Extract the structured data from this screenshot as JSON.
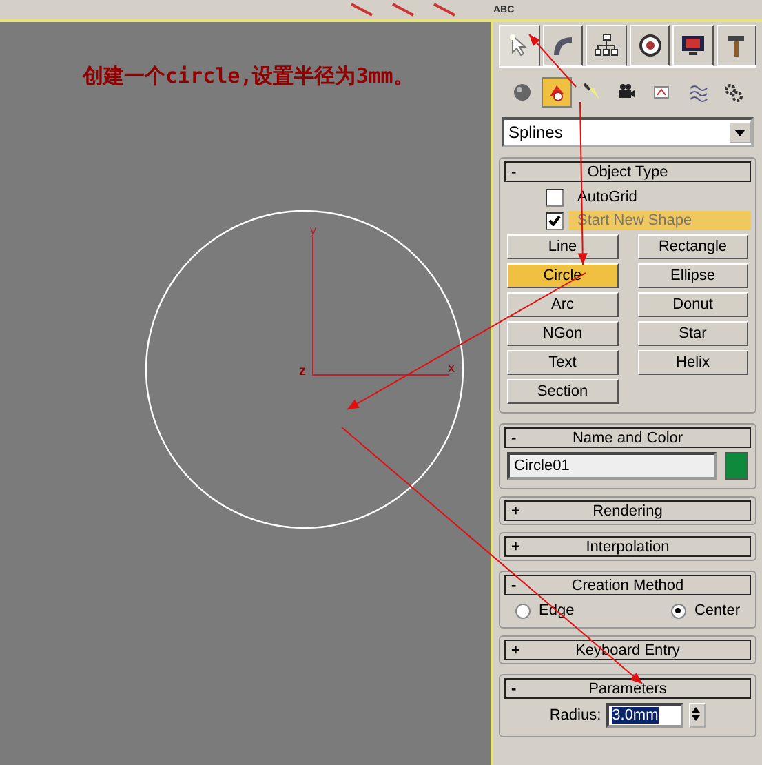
{
  "toolbar": {
    "label": "ABC"
  },
  "viewport": {
    "annotation": "创建一个circle,设置半径为3mm。",
    "axis_labels": {
      "x": "x",
      "y": "y",
      "z": "z"
    }
  },
  "command_panel": {
    "tabs": [
      {
        "selected": true
      },
      {
        "selected": false
      },
      {
        "selected": false
      },
      {
        "selected": false
      },
      {
        "selected": false
      },
      {
        "selected": false
      }
    ],
    "categories": [
      {
        "selected": false
      },
      {
        "selected": true
      },
      {
        "selected": false
      },
      {
        "selected": false
      },
      {
        "selected": false
      },
      {
        "selected": false
      },
      {
        "selected": false
      }
    ],
    "dropdown": {
      "value": "Splines"
    },
    "rollouts": [
      {
        "kind": "object_type",
        "sign": "-",
        "title": "Object Type",
        "expanded": true,
        "checks": [
          {
            "label": "AutoGrid",
            "checked": false,
            "highlighted": false
          },
          {
            "label": "Start New Shape",
            "checked": true,
            "highlighted": true
          }
        ],
        "buttons": [
          {
            "label": "Line",
            "selected": false
          },
          {
            "label": "Rectangle",
            "selected": false
          },
          {
            "label": "Circle",
            "selected": true
          },
          {
            "label": "Ellipse",
            "selected": false
          },
          {
            "label": "Arc",
            "selected": false
          },
          {
            "label": "Donut",
            "selected": false
          },
          {
            "label": "NGon",
            "selected": false
          },
          {
            "label": "Star",
            "selected": false
          },
          {
            "label": "Text",
            "selected": false
          },
          {
            "label": "Helix",
            "selected": false
          },
          {
            "label": "Section",
            "selected": false
          }
        ]
      },
      {
        "kind": "name_color",
        "sign": "-",
        "title": "Name and Color",
        "expanded": true,
        "name": "Circle01",
        "color": "#0f8a3c"
      },
      {
        "kind": "plain",
        "sign": "+",
        "title": "Rendering",
        "expanded": false
      },
      {
        "kind": "plain",
        "sign": "+",
        "title": "Interpolation",
        "expanded": false
      },
      {
        "kind": "radios",
        "sign": "-",
        "title": "Creation Method",
        "expanded": true,
        "options": [
          {
            "label": "Edge",
            "selected": false
          },
          {
            "label": "Center",
            "selected": true
          }
        ]
      },
      {
        "kind": "plain",
        "sign": "+",
        "title": "Keyboard Entry",
        "expanded": false
      },
      {
        "kind": "params",
        "sign": "-",
        "title": "Parameters",
        "expanded": true,
        "label": "Radius:",
        "value": "3.0mm"
      }
    ]
  }
}
